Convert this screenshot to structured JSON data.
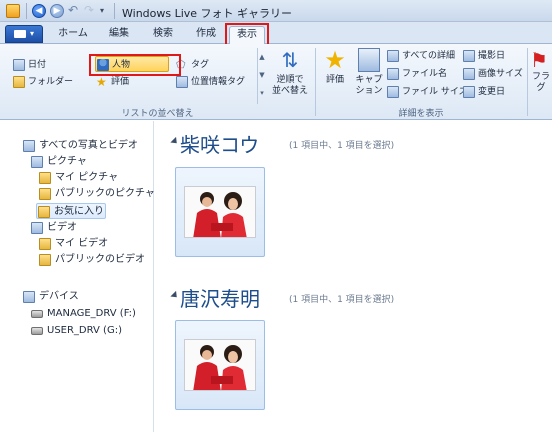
{
  "window": {
    "title": "Windows Live フォト ギャラリー"
  },
  "tabs": [
    "ホーム",
    "編集",
    "検索",
    "作成",
    "表示"
  ],
  "active_tab": "表示",
  "ribbon": {
    "sort_group": {
      "label": "リストの並べ替え",
      "items": [
        "日付",
        "フォルダー",
        "人物",
        "評価",
        "タグ",
        "位置情報タグ"
      ],
      "selected": "人物",
      "reverse_sort": "逆順で\n並べ替え"
    },
    "details_group": {
      "label": "詳細を表示",
      "rating": "評価",
      "caption": "キャプ\nション",
      "options": [
        "すべての詳細",
        "ファイル名",
        "ファイル サイズ",
        "撮影日",
        "画像サイズ",
        "変更日"
      ],
      "flag": "フラグ"
    }
  },
  "nav": {
    "items": [
      {
        "label": "すべての写真とビデオ",
        "icon": "library-icon"
      },
      {
        "label": "ピクチャ",
        "icon": "library-icon"
      },
      {
        "label": "マイ ピクチャ",
        "icon": "folder-icon"
      },
      {
        "label": "パブリックのピクチャ",
        "icon": "folder-icon"
      },
      {
        "label": "お気に入り",
        "icon": "folder-icon"
      },
      {
        "label": "ビデオ",
        "icon": "library-icon"
      },
      {
        "label": "マイ ビデオ",
        "icon": "folder-icon"
      },
      {
        "label": "パブリックのビデオ",
        "icon": "folder-icon"
      },
      {
        "label": "デバイス",
        "icon": "device-icon"
      },
      {
        "label": "MANAGE_DRV (F:)",
        "icon": "drive-icon"
      },
      {
        "label": "USER_DRV (G:)",
        "icon": "drive-icon"
      }
    ],
    "selected": "お気に入り"
  },
  "groups": [
    {
      "name": "柴咲コウ",
      "count": "(1 項目中、1 項目を選択)"
    },
    {
      "name": "唐沢寿明",
      "count": "(1 項目中、1 項目を選択)"
    }
  ],
  "colors": {
    "accent": "#1e4d8c",
    "highlight_box": "#e01818",
    "selection": "#ffd35c"
  }
}
